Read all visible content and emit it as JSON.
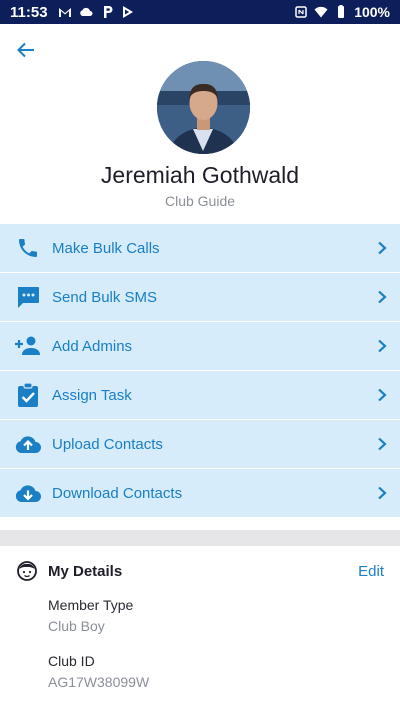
{
  "status_bar": {
    "time": "11:53",
    "battery": "100%"
  },
  "profile": {
    "name": "Jeremiah Gothwald",
    "role": "Club Guide"
  },
  "actions": [
    {
      "label": "Make Bulk Calls",
      "icon": "phone-icon"
    },
    {
      "label": "Send Bulk SMS",
      "icon": "sms-icon"
    },
    {
      "label": "Add Admins",
      "icon": "add-person-icon"
    },
    {
      "label": "Assign Task",
      "icon": "clipboard-check-icon"
    },
    {
      "label": "Upload Contacts",
      "icon": "cloud-upload-icon"
    },
    {
      "label": "Download Contacts",
      "icon": "cloud-download-icon"
    }
  ],
  "details": {
    "title": "My Details",
    "edit_label": "Edit",
    "fields": [
      {
        "label": "Member Type",
        "value": "Club Boy"
      },
      {
        "label": "Club ID",
        "value": "AG17W38099W"
      }
    ]
  },
  "colors": {
    "accent": "#1a7fc4",
    "action_bg": "#d6ecfb",
    "status_bar": "#0d1f5a"
  }
}
